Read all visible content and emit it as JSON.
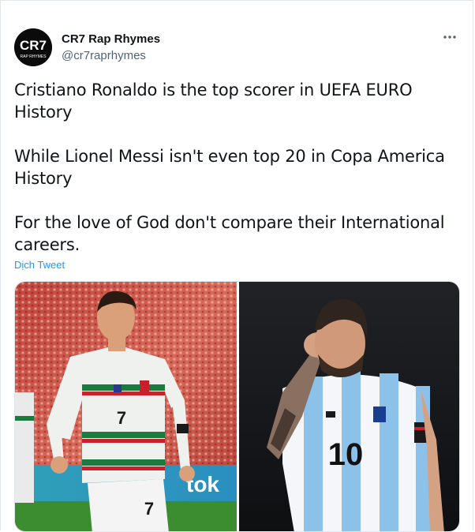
{
  "author": {
    "display_name": "CR7 Rap Rhymes",
    "handle": "@cr7raprhymes",
    "avatar": {
      "logo_text": "CR7",
      "sub_text": "RAP RHYMES"
    }
  },
  "tweet": {
    "paragraphs": [
      "Cristiano Ronaldo is the top scorer in UEFA EURO History",
      "While Lionel Messi isn't even top 20 in Copa America History",
      "For the love of God don't compare their International careers."
    ],
    "translate_label": "Dịch Tweet",
    "media": [
      {
        "kind": "photo",
        "subject": "player in white and red-green striped kit celebrating",
        "shirt_number": "7",
        "shorts_number": "7",
        "ad_board_text": "tok"
      },
      {
        "kind": "photo",
        "subject": "player in light blue and white striped kit with hand on forehead",
        "shirt_number": "10"
      }
    ]
  },
  "icons": {
    "more": "more-horizontal-icon"
  },
  "colors": {
    "link": "#1d9bf0",
    "text": "#0f1419",
    "secondary_text": "#536471",
    "border": "#e1e8ed"
  }
}
